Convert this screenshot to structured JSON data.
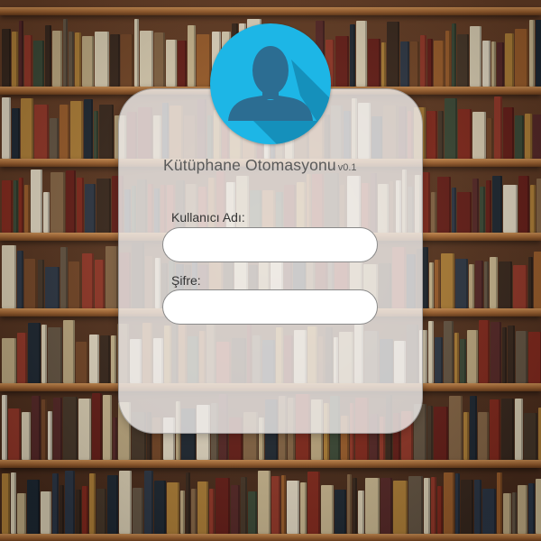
{
  "app": {
    "title": "Kütüphane Otomasyonu",
    "version": "v0.1"
  },
  "form": {
    "username_label": "Kullanıcı Adı:",
    "username_value": "",
    "password_label": "Şifre:",
    "password_value": ""
  },
  "icons": {
    "avatar": "user-silhouette-icon"
  },
  "colors": {
    "avatar_bg": "#1db6e6",
    "avatar_shadow": "#1590bb",
    "avatar_figure": "#2c6d92"
  }
}
